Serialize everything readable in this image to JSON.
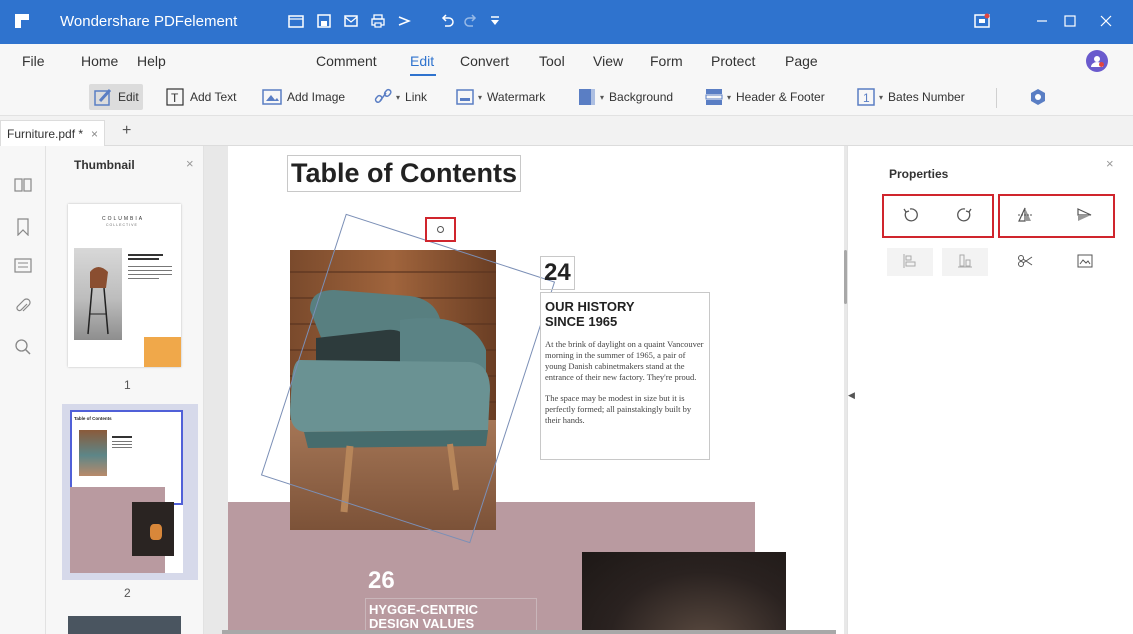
{
  "app": {
    "title": "Wondershare PDFelement",
    "colors": {
      "titlebar": "#2f73ce",
      "accent": "#2f73ce",
      "highlight": "#d0252d"
    }
  },
  "titlebar": {
    "quick_icons": [
      "folder-icon",
      "save-icon",
      "mail-icon",
      "print-icon",
      "share-icon",
      "undo-icon",
      "redo-icon",
      "customize-dropdown-icon"
    ],
    "window_controls": [
      "minimize-icon",
      "maximize-icon",
      "close-icon"
    ]
  },
  "menu": {
    "left": [
      "File",
      "Home",
      "Help"
    ],
    "tabs": [
      "Comment",
      "Edit",
      "Convert",
      "Tool",
      "View",
      "Form",
      "Protect",
      "Page"
    ],
    "active": "Edit"
  },
  "toolbar": {
    "edit": "Edit",
    "add_text": "Add Text",
    "add_image": "Add Image",
    "link": "Link",
    "watermark": "Watermark",
    "background": "Background",
    "header_footer": "Header & Footer",
    "bates_number": "Bates Number"
  },
  "tab": {
    "filename": "Furniture.pdf *",
    "close": "×",
    "new": "+"
  },
  "thumbnail_panel": {
    "title": "Thumbnail",
    "close": "×",
    "pages": [
      "1",
      "2"
    ],
    "page1": {
      "brand": "COLUMBIA",
      "sub": "COLLECTIVE"
    },
    "page2": {
      "title": "Table of Contents"
    }
  },
  "document": {
    "toc_title": "Table of Contents",
    "section1": {
      "number": "24",
      "title": "OUR HISTORY\nSINCE 1965",
      "para1": "At the brink of daylight on a quaint Vancouver morning in the summer of 1965, a pair of young Danish cabinetmakers stand at the entrance of their new factory. They're proud.",
      "para2": "The space may be modest in size but it is perfectly formed; all painstakingly built by their hands."
    },
    "section2": {
      "number": "26",
      "title": "HYGGE-CENTRIC\nDESIGN VALUES"
    }
  },
  "properties": {
    "title": "Properties",
    "close": "×",
    "row1": [
      "rotate-left-icon",
      "rotate-right-icon",
      "flip-vertical-icon",
      "flip-horizontal-icon"
    ],
    "row2": [
      "align-left-icon",
      "align-bottom-icon",
      "crop-icon",
      "replace-image-icon"
    ]
  }
}
